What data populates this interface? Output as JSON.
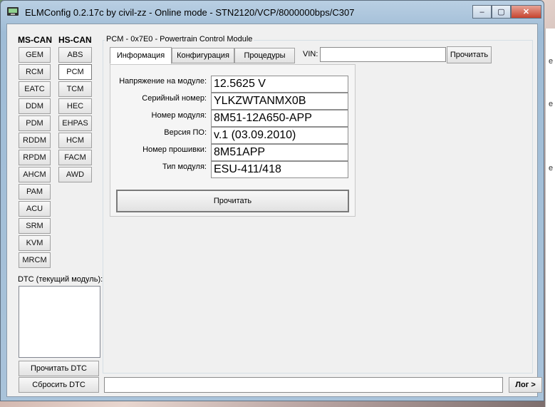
{
  "window": {
    "title": "ELMConfig 0.2.17c by civil-zz - Online mode - STN2120/VCP/8000000bps/C307",
    "minimize": "–",
    "maximize": "▢",
    "close": "✕"
  },
  "left": {
    "ms_can_header": "MS-CAN",
    "hs_can_header": "HS-CAN",
    "ms_can": [
      "GEM",
      "RCM",
      "EATC",
      "DDM",
      "PDM",
      "RDDM",
      "RPDM",
      "AHCM",
      "PAM",
      "ACU",
      "SRM",
      "KVM",
      "MRCM"
    ],
    "hs_can": [
      "ABS",
      "PCM",
      "TCM",
      "HEC",
      "EHPAS",
      "HCM",
      "FACM",
      "AWD"
    ],
    "selected_hs": "PCM",
    "dtc_label": "DTC (текущий модуль):",
    "read_dtc": "Прочитать DTC",
    "clear_dtc": "Сбросить DTC"
  },
  "module": {
    "group_title": "PCM - 0x7E0 - Powertrain Control Module",
    "tabs": [
      "Информация",
      "Конфигурация",
      "Процедуры"
    ],
    "active_tab": "Информация",
    "vin_label": "VIN:",
    "vin_value": "",
    "vin_read": "Прочитать",
    "info": [
      {
        "label": "Напряжение на модуле:",
        "value": "12.5625 V"
      },
      {
        "label": "Серийный номер:",
        "value": "YLKZWTANMX0B"
      },
      {
        "label": "Номер модуля:",
        "value": "8M51-12A650-APP"
      },
      {
        "label": "Версия ПО:",
        "value": "v.1 (03.09.2010)"
      },
      {
        "label": "Номер прошивки:",
        "value": "8M51APP"
      },
      {
        "label": "Тип модуля:",
        "value": "ESU-411/418"
      }
    ],
    "read_button": "Прочитать"
  },
  "bottom": {
    "status_value": "",
    "log_button": "Лог >"
  },
  "desktop": {
    "right_letters": [
      "e",
      "е",
      "e"
    ]
  }
}
